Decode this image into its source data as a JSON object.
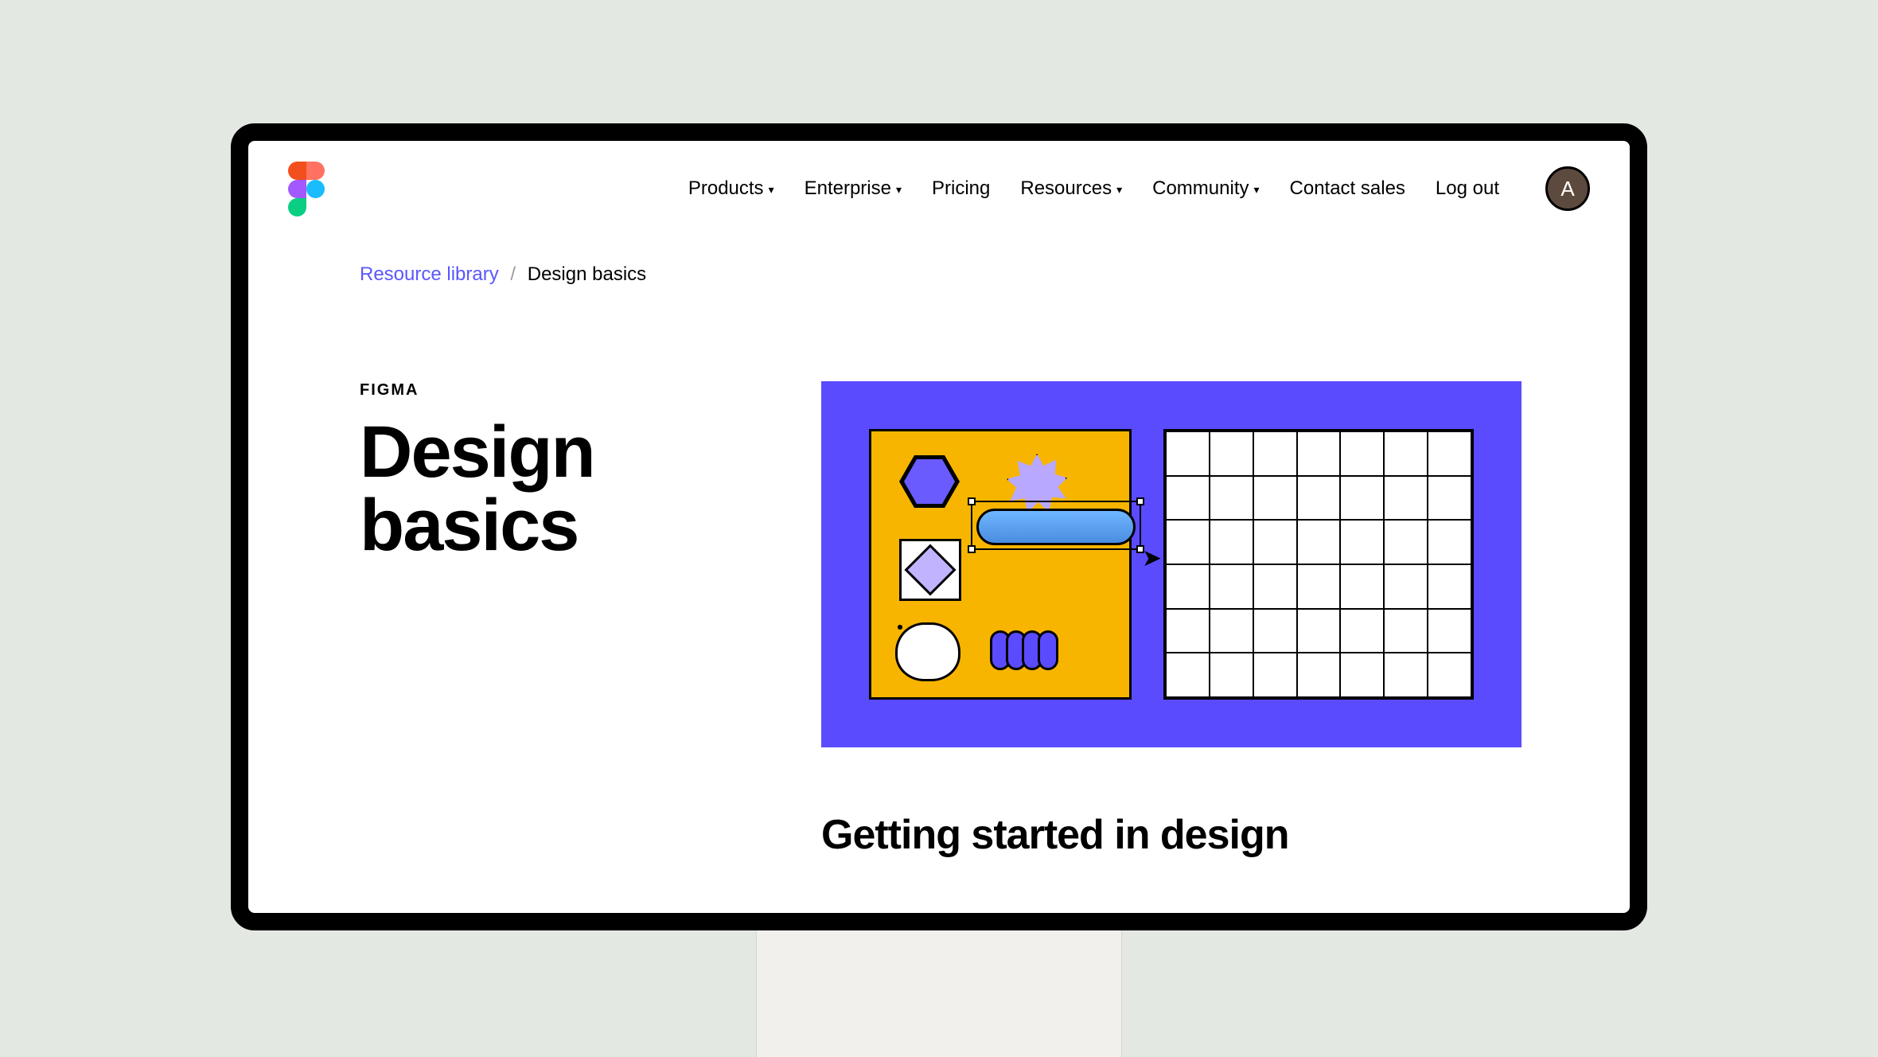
{
  "nav": {
    "items": [
      {
        "label": "Products",
        "dropdown": true
      },
      {
        "label": "Enterprise",
        "dropdown": true
      },
      {
        "label": "Pricing",
        "dropdown": false
      },
      {
        "label": "Resources",
        "dropdown": true
      },
      {
        "label": "Community",
        "dropdown": true
      },
      {
        "label": "Contact sales",
        "dropdown": false
      },
      {
        "label": "Log out",
        "dropdown": false
      }
    ],
    "avatar_initial": "A"
  },
  "breadcrumb": {
    "root": "Resource library",
    "current": "Design basics"
  },
  "hero": {
    "eyebrow": "FIGMA",
    "title": "Design basics"
  },
  "section": {
    "heading": "Getting started in design"
  }
}
